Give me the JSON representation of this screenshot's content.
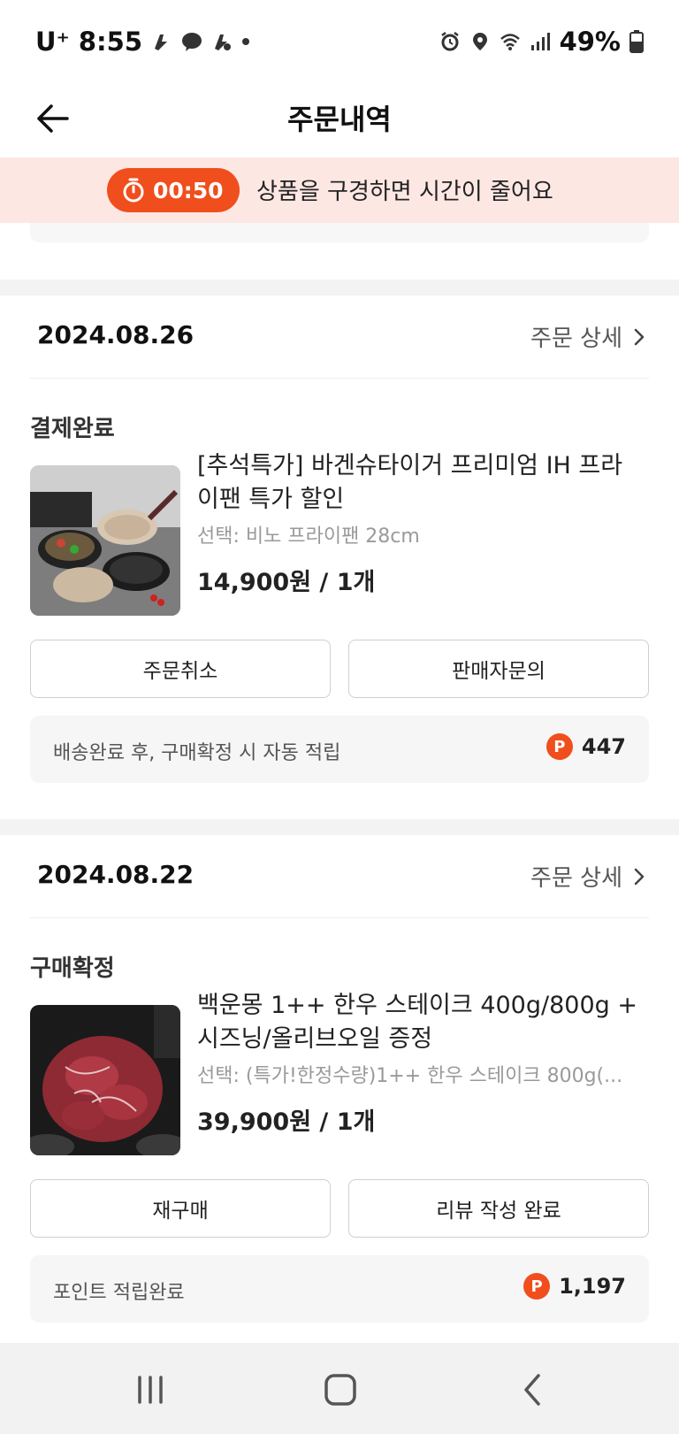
{
  "status_bar": {
    "carrier": "U⁺",
    "time": "8:55",
    "battery": "49%"
  },
  "header": {
    "title": "주문내역"
  },
  "timer": {
    "countdown": "00:50",
    "message": "상품을 구경하면 시간이 줄어요"
  },
  "orders": [
    {
      "date": "2024.08.26",
      "detail_label": "주문 상세",
      "status": "결제완료",
      "product_title": "[추석특가] 바겐슈타이거 프리미엄 IH 프라이팬 특가 할인",
      "option": "선택: 비노 프라이팬 28cm",
      "price": "14,900원 / 1개",
      "buttons": [
        "주문취소",
        "판매자문의"
      ],
      "points_text": "배송완료 후, 구매확정 시 자동 적립",
      "points_value": "447"
    },
    {
      "date": "2024.08.22",
      "detail_label": "주문 상세",
      "status": "구매확정",
      "product_title": "백운몽 1++ 한우 스테이크 400g/800g + 시즈닝/올리브오일 증정",
      "option": "선택: (특가!한정수량)1++ 한우 스테이크 800g(...",
      "price": "39,900원 / 1개",
      "buttons": [
        "재구매",
        "리뷰 작성 완료"
      ],
      "points_text": "포인트 적립완료",
      "points_value": "1,197"
    }
  ],
  "point_badge": "P",
  "colors": {
    "accent": "#f04e1c",
    "banner_bg": "#fde7e3"
  }
}
